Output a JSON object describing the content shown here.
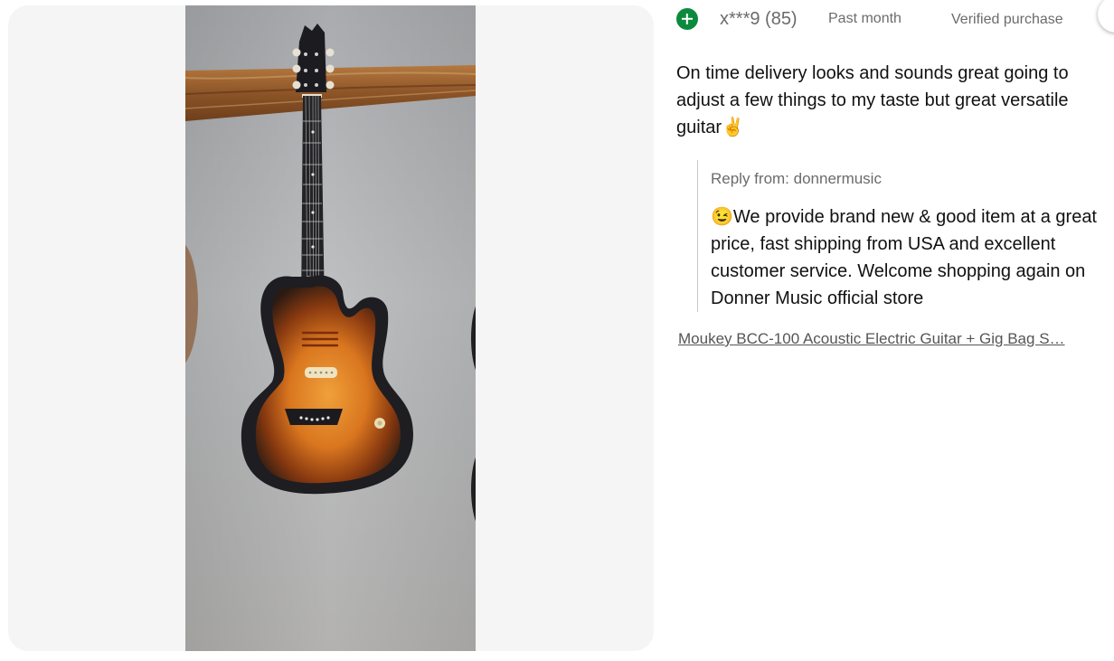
{
  "review": {
    "username": "x***9 (85)",
    "time": "Past month",
    "verified": "Verified purchase",
    "text": "On time delivery looks and sounds great going to adjust a few things to my taste but great versatile guitar✌️",
    "reply": {
      "label": "Reply from: donnermusic",
      "text": "😉We provide brand new & good item at a great price, fast shipping from USA and excellent customer service. Welcome shopping again on Donner Music official store"
    },
    "product_link": "Moukey BCC-100 Acoustic Electric Guitar + Gig Bag S…"
  },
  "icons": {
    "badge": "plus-circle-icon",
    "corner": "close-button"
  },
  "colors": {
    "badge_green": "#0b8a3e",
    "panel_bg": "#f5f5f5",
    "meta_gray": "#6b6b6b"
  }
}
